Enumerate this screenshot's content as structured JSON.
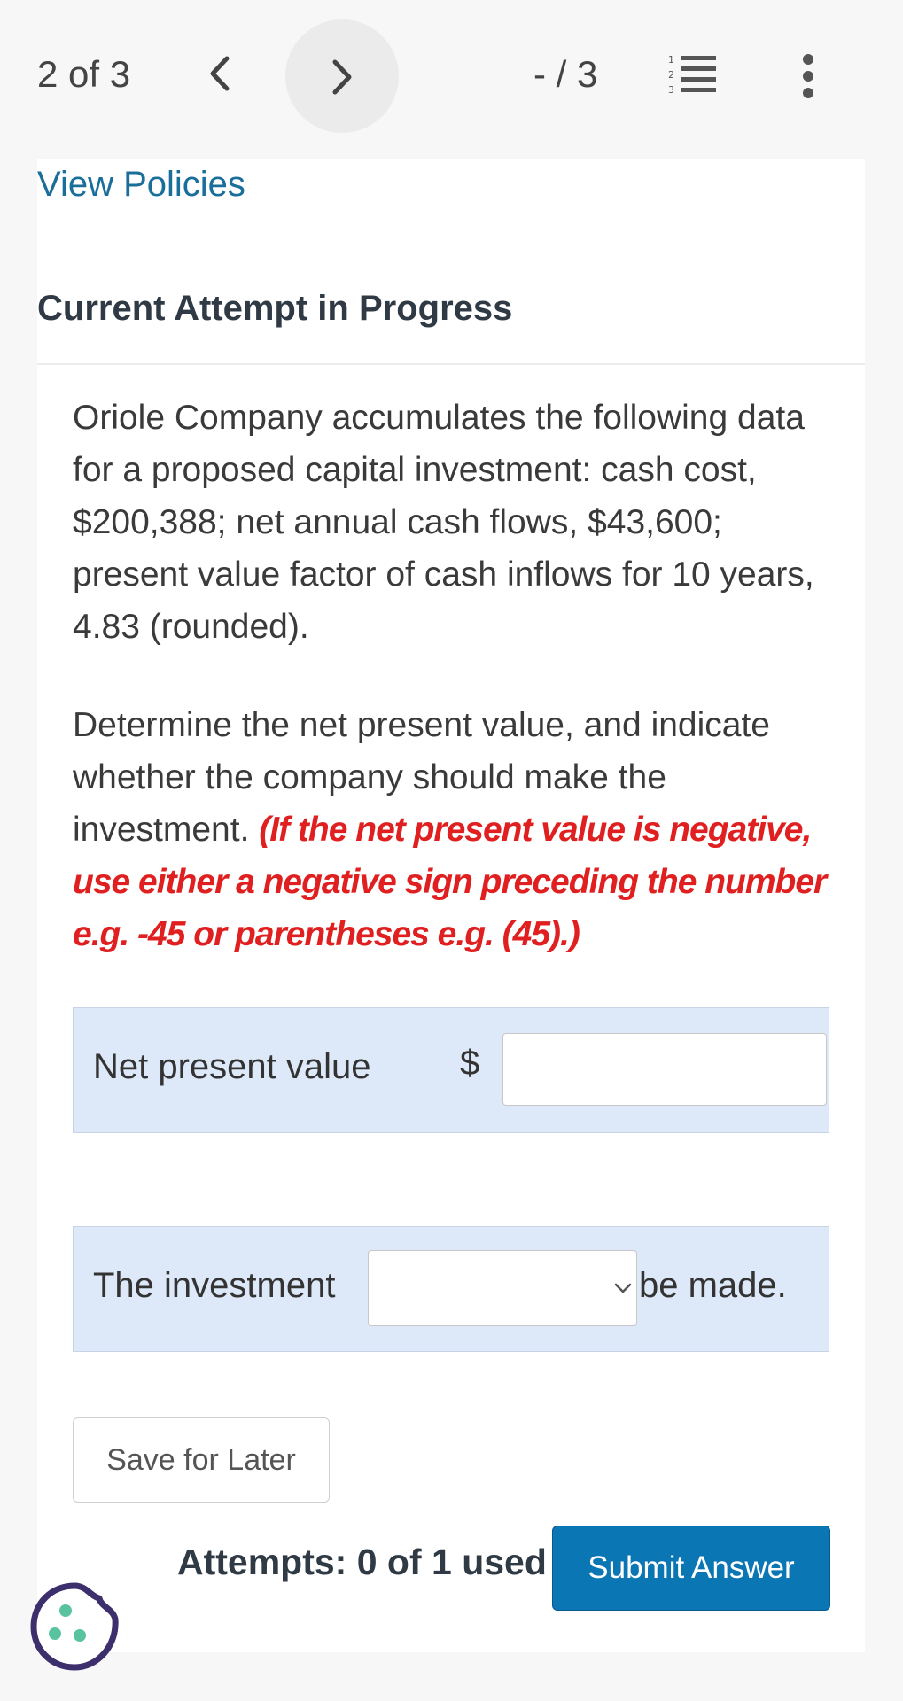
{
  "topbar": {
    "counter": "2 of 3",
    "score": "- / 3",
    "prev_icon": "chevron-left-icon",
    "next_icon": "chevron-right-icon",
    "list_icon": "numbered-list-icon",
    "more_icon": "more-vertical-icon"
  },
  "links": {
    "view_policies": "View Policies"
  },
  "heading": "Current Attempt in Progress",
  "question": {
    "paragraph1": "Oriole Company accumulates the following data for a proposed capital investment: cash cost, $200,388; net annual cash flows, $43,600; present value factor of cash inflows for 10 years, 4.83 (rounded).",
    "paragraph2_text": "Determine the net present value, and indicate whether the company should make the investment.",
    "paragraph2_note": "(If the net present value is negative, use either a negative sign preceding the number e.g. -45 or parentheses e.g. (45).)"
  },
  "npv_row": {
    "label": "Net present value",
    "currency": "$",
    "value": ""
  },
  "investment_row": {
    "label": "The investment",
    "selected": "",
    "suffix": "be made."
  },
  "buttons": {
    "save": "Save for Later",
    "submit": "Submit Answer"
  },
  "attempts": "Attempts: 0 of 1 used",
  "colors": {
    "accent": "#0a76b4",
    "link": "#1a6e9a",
    "note": "#e02020",
    "row_bg": "#dde8f8"
  },
  "cookie_icon": "cookie-icon"
}
